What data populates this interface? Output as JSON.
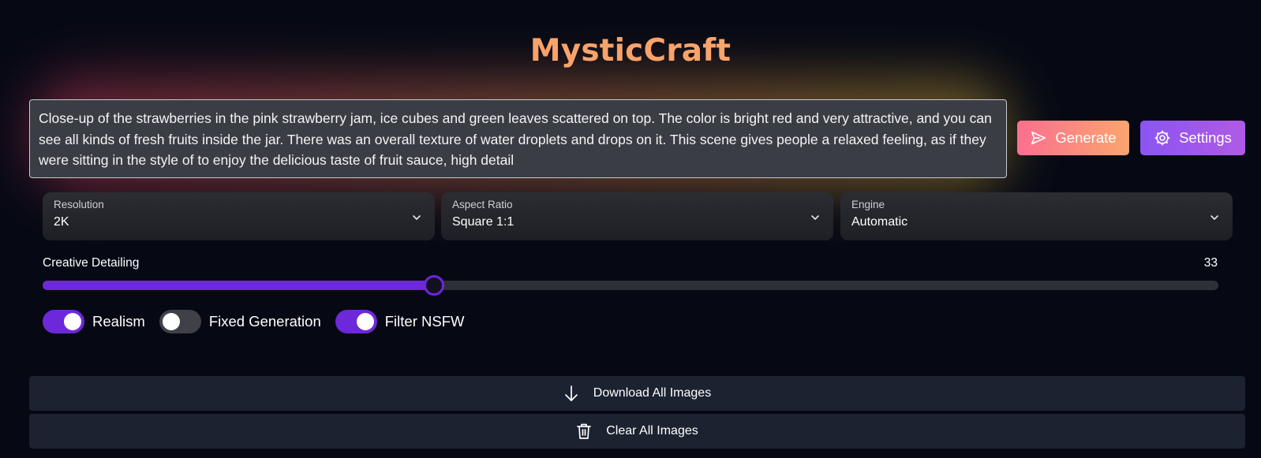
{
  "app": {
    "title": "MysticCraft"
  },
  "prompt": {
    "value": "Close-up of the strawberries in the pink strawberry jam, ice cubes and green leaves scattered on top. The color is bright red and very attractive, and you can see all kinds of fresh fruits inside the jar. There was an overall texture of water droplets and drops on it. This scene gives people a relaxed feeling, as if they were sitting in the style of to enjoy the delicious taste of fruit sauce, high detail"
  },
  "actions": {
    "generate_label": "Generate",
    "settings_label": "Settings"
  },
  "options": {
    "resolution": {
      "label": "Resolution",
      "value": "2K"
    },
    "aspect_ratio": {
      "label": "Aspect Ratio",
      "value": "Square 1:1"
    },
    "engine": {
      "label": "Engine",
      "value": "Automatic"
    }
  },
  "creative_detailing": {
    "label": "Creative Detailing",
    "value": "33",
    "fill_fraction": 0.333
  },
  "toggles": [
    {
      "label": "Realism",
      "on": true
    },
    {
      "label": "Fixed Generation",
      "on": false
    },
    {
      "label": "Filter NSFW",
      "on": true
    }
  ],
  "footer": {
    "download_label": "Download All Images",
    "clear_label": "Clear All Images"
  },
  "colors": {
    "accent": "#6d28d9",
    "title": "#f9a46c",
    "background": "#060914"
  },
  "icons": {
    "generate": "send-icon",
    "settings": "gear-icon",
    "dropdown": "chevron-down-icon",
    "download": "arrow-down-icon",
    "clear": "trash-icon"
  }
}
